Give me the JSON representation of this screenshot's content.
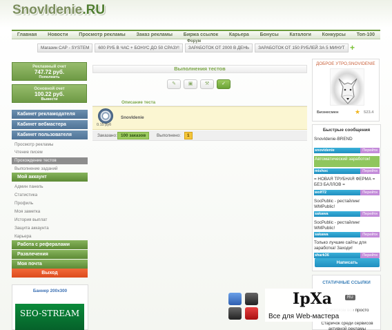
{
  "header": {
    "logo_main": "SnovIdenie",
    "logo_tld": ".RU",
    "nav": [
      "Главная",
      "Новости",
      "Просмотр рекламы",
      "Заказ рекламы",
      "Биржа ссылок",
      "Карьера",
      "Бонусы",
      "Каталоги",
      "Конкурсы",
      "Топ-100"
    ],
    "nav_sub": "Форум",
    "ad_links": [
      "Магазин САР - SYSTEM",
      "600 РУБ В ЧАС + БОНУС ДО 50 СРАЗУ!",
      "ЗАРАБОТОК ОТ 2000 В ДЕНЬ",
      "ЗАРАБОТОК ОТ 150 РУБЛЕЙ ЗА 5 МИНУТ"
    ],
    "ad_add": "+"
  },
  "left": {
    "adv_account": {
      "label": "Рекламный счет",
      "value": "747.72 руб.",
      "action": "Пополнить"
    },
    "main_account": {
      "label": "Основной счет",
      "value": "100.22 руб.",
      "action": "Вывести"
    },
    "cabinets": [
      "Кабинет рекламодателя",
      "Кабинет вебмастера",
      "Кабинет пользователя"
    ],
    "user_items": [
      "Просмотр рекламы",
      "Чтение писем"
    ],
    "active_item": "Прохождение тестов",
    "user_items_after": [
      "Выполнение заданий"
    ],
    "my_account": "Мой аккаунт",
    "account_items": [
      "Админ панель",
      "Статистика",
      "Профиль",
      "Моя заметка",
      "История выплат",
      "Защита аккаунта",
      "Карьера"
    ],
    "referrals": "Работа с рефералами",
    "fun": "Развлечения",
    "mail": "Моя почта",
    "logout": "Выход",
    "banner_title": "Баннер 200x300",
    "banner_text": "SEO-STREAM"
  },
  "center": {
    "title": "Выполнения тестов",
    "desc_label": "Описание теста",
    "task_price": "0.15 руб",
    "task_name": "SnovIdenie",
    "ordered_label": "Заказано:",
    "ordered_value": "100 заказов",
    "done_label": "Выполнено:",
    "done_value": "1"
  },
  "right": {
    "greeting": "ДОБРОЕ УТРО,SNOVIDENIE",
    "rank": "Бизнесмен",
    "rating": "523.4",
    "messages_title": "Быстрые сообщения",
    "reply": "Перейти",
    "messages": [
      {
        "text": "SnovIdenie-BREND",
        "user": "snovidenie",
        "green": false
      },
      {
        "text": "Автоматический заработок!",
        "user": "mishoc",
        "green": true
      },
      {
        "text": "= НОВАЯ ТРУБНАЯ ФЕРМА = БЕЗ БАЛЛОВ =",
        "user": "wolf72",
        "green": false
      },
      {
        "text": "SocPublic - рестайлинг WMPublic!",
        "user": "sakawa",
        "green": false
      },
      {
        "text": "SocPublic - рестайлинг WMPublic!",
        "user": "sakawa",
        "green": false
      },
      {
        "text": "Только лучшие сайты для заработка! Заходи!",
        "user": "shark36",
        "green": false
      }
    ],
    "write_button": "Написать",
    "links_title": "СТАТИЧНЫЕ ССЫЛКИ",
    "link1": "С игроком все просто",
    "link2": "Старичок среди сервисов активной рекламы"
  },
  "watermark": {
    "logo": "IpXa",
    "badge": "RU",
    "tagline": "Все для Web-мастера"
  },
  "colors": {
    "accent_green": "#6b9a3a",
    "blue_header": "#4f7396",
    "logout": "#e0501f",
    "message_blue": "#1f8fc0"
  }
}
